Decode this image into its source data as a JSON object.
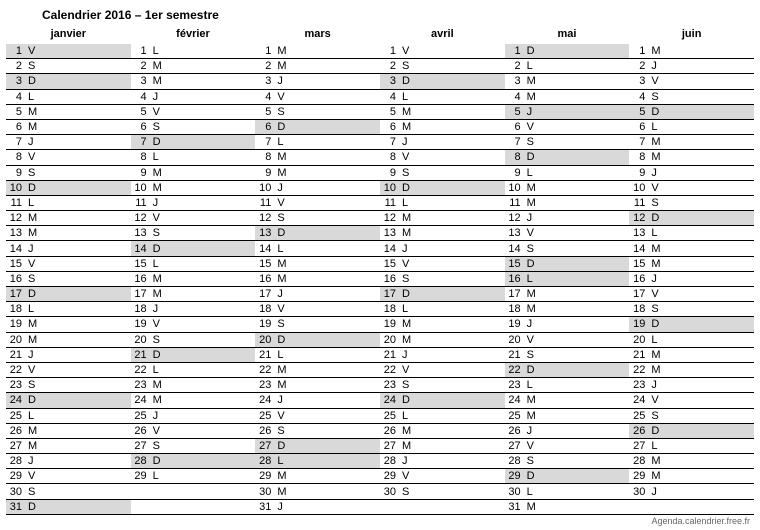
{
  "title": "Calendrier 2016 – 1er semestre",
  "footer": "Agenda.calendrier.free.fr",
  "months": [
    {
      "name": "janvier",
      "days": [
        {
          "num": 1,
          "dow": "V",
          "shade": true
        },
        {
          "num": 2,
          "dow": "S",
          "shade": false
        },
        {
          "num": 3,
          "dow": "D",
          "shade": true
        },
        {
          "num": 4,
          "dow": "L",
          "shade": false
        },
        {
          "num": 5,
          "dow": "M",
          "shade": false
        },
        {
          "num": 6,
          "dow": "M",
          "shade": false
        },
        {
          "num": 7,
          "dow": "J",
          "shade": false
        },
        {
          "num": 8,
          "dow": "V",
          "shade": false
        },
        {
          "num": 9,
          "dow": "S",
          "shade": false
        },
        {
          "num": 10,
          "dow": "D",
          "shade": true
        },
        {
          "num": 11,
          "dow": "L",
          "shade": false
        },
        {
          "num": 12,
          "dow": "M",
          "shade": false
        },
        {
          "num": 13,
          "dow": "M",
          "shade": false
        },
        {
          "num": 14,
          "dow": "J",
          "shade": false
        },
        {
          "num": 15,
          "dow": "V",
          "shade": false
        },
        {
          "num": 16,
          "dow": "S",
          "shade": false
        },
        {
          "num": 17,
          "dow": "D",
          "shade": true
        },
        {
          "num": 18,
          "dow": "L",
          "shade": false
        },
        {
          "num": 19,
          "dow": "M",
          "shade": false
        },
        {
          "num": 20,
          "dow": "M",
          "shade": false
        },
        {
          "num": 21,
          "dow": "J",
          "shade": false
        },
        {
          "num": 22,
          "dow": "V",
          "shade": false
        },
        {
          "num": 23,
          "dow": "S",
          "shade": false
        },
        {
          "num": 24,
          "dow": "D",
          "shade": true
        },
        {
          "num": 25,
          "dow": "L",
          "shade": false
        },
        {
          "num": 26,
          "dow": "M",
          "shade": false
        },
        {
          "num": 27,
          "dow": "M",
          "shade": false
        },
        {
          "num": 28,
          "dow": "J",
          "shade": false
        },
        {
          "num": 29,
          "dow": "V",
          "shade": false
        },
        {
          "num": 30,
          "dow": "S",
          "shade": false
        },
        {
          "num": 31,
          "dow": "D",
          "shade": true
        }
      ]
    },
    {
      "name": "février",
      "days": [
        {
          "num": 1,
          "dow": "L",
          "shade": false
        },
        {
          "num": 2,
          "dow": "M",
          "shade": false
        },
        {
          "num": 3,
          "dow": "M",
          "shade": false
        },
        {
          "num": 4,
          "dow": "J",
          "shade": false
        },
        {
          "num": 5,
          "dow": "V",
          "shade": false
        },
        {
          "num": 6,
          "dow": "S",
          "shade": false
        },
        {
          "num": 7,
          "dow": "D",
          "shade": true
        },
        {
          "num": 8,
          "dow": "L",
          "shade": false
        },
        {
          "num": 9,
          "dow": "M",
          "shade": false
        },
        {
          "num": 10,
          "dow": "M",
          "shade": false
        },
        {
          "num": 11,
          "dow": "J",
          "shade": false
        },
        {
          "num": 12,
          "dow": "V",
          "shade": false
        },
        {
          "num": 13,
          "dow": "S",
          "shade": false
        },
        {
          "num": 14,
          "dow": "D",
          "shade": true
        },
        {
          "num": 15,
          "dow": "L",
          "shade": false
        },
        {
          "num": 16,
          "dow": "M",
          "shade": false
        },
        {
          "num": 17,
          "dow": "M",
          "shade": false
        },
        {
          "num": 18,
          "dow": "J",
          "shade": false
        },
        {
          "num": 19,
          "dow": "V",
          "shade": false
        },
        {
          "num": 20,
          "dow": "S",
          "shade": false
        },
        {
          "num": 21,
          "dow": "D",
          "shade": true
        },
        {
          "num": 22,
          "dow": "L",
          "shade": false
        },
        {
          "num": 23,
          "dow": "M",
          "shade": false
        },
        {
          "num": 24,
          "dow": "M",
          "shade": false
        },
        {
          "num": 25,
          "dow": "J",
          "shade": false
        },
        {
          "num": 26,
          "dow": "V",
          "shade": false
        },
        {
          "num": 27,
          "dow": "S",
          "shade": false
        },
        {
          "num": 28,
          "dow": "D",
          "shade": true
        },
        {
          "num": 29,
          "dow": "L",
          "shade": false
        }
      ]
    },
    {
      "name": "mars",
      "days": [
        {
          "num": 1,
          "dow": "M",
          "shade": false
        },
        {
          "num": 2,
          "dow": "M",
          "shade": false
        },
        {
          "num": 3,
          "dow": "J",
          "shade": false
        },
        {
          "num": 4,
          "dow": "V",
          "shade": false
        },
        {
          "num": 5,
          "dow": "S",
          "shade": false
        },
        {
          "num": 6,
          "dow": "D",
          "shade": true
        },
        {
          "num": 7,
          "dow": "L",
          "shade": false
        },
        {
          "num": 8,
          "dow": "M",
          "shade": false
        },
        {
          "num": 9,
          "dow": "M",
          "shade": false
        },
        {
          "num": 10,
          "dow": "J",
          "shade": false
        },
        {
          "num": 11,
          "dow": "V",
          "shade": false
        },
        {
          "num": 12,
          "dow": "S",
          "shade": false
        },
        {
          "num": 13,
          "dow": "D",
          "shade": true
        },
        {
          "num": 14,
          "dow": "L",
          "shade": false
        },
        {
          "num": 15,
          "dow": "M",
          "shade": false
        },
        {
          "num": 16,
          "dow": "M",
          "shade": false
        },
        {
          "num": 17,
          "dow": "J",
          "shade": false
        },
        {
          "num": 18,
          "dow": "V",
          "shade": false
        },
        {
          "num": 19,
          "dow": "S",
          "shade": false
        },
        {
          "num": 20,
          "dow": "D",
          "shade": true
        },
        {
          "num": 21,
          "dow": "L",
          "shade": false
        },
        {
          "num": 22,
          "dow": "M",
          "shade": false
        },
        {
          "num": 23,
          "dow": "M",
          "shade": false
        },
        {
          "num": 24,
          "dow": "J",
          "shade": false
        },
        {
          "num": 25,
          "dow": "V",
          "shade": false
        },
        {
          "num": 26,
          "dow": "S",
          "shade": false
        },
        {
          "num": 27,
          "dow": "D",
          "shade": true
        },
        {
          "num": 28,
          "dow": "L",
          "shade": true
        },
        {
          "num": 29,
          "dow": "M",
          "shade": false
        },
        {
          "num": 30,
          "dow": "M",
          "shade": false
        },
        {
          "num": 31,
          "dow": "J",
          "shade": false
        }
      ]
    },
    {
      "name": "avril",
      "days": [
        {
          "num": 1,
          "dow": "V",
          "shade": false
        },
        {
          "num": 2,
          "dow": "S",
          "shade": false
        },
        {
          "num": 3,
          "dow": "D",
          "shade": true
        },
        {
          "num": 4,
          "dow": "L",
          "shade": false
        },
        {
          "num": 5,
          "dow": "M",
          "shade": false
        },
        {
          "num": 6,
          "dow": "M",
          "shade": false
        },
        {
          "num": 7,
          "dow": "J",
          "shade": false
        },
        {
          "num": 8,
          "dow": "V",
          "shade": false
        },
        {
          "num": 9,
          "dow": "S",
          "shade": false
        },
        {
          "num": 10,
          "dow": "D",
          "shade": true
        },
        {
          "num": 11,
          "dow": "L",
          "shade": false
        },
        {
          "num": 12,
          "dow": "M",
          "shade": false
        },
        {
          "num": 13,
          "dow": "M",
          "shade": false
        },
        {
          "num": 14,
          "dow": "J",
          "shade": false
        },
        {
          "num": 15,
          "dow": "V",
          "shade": false
        },
        {
          "num": 16,
          "dow": "S",
          "shade": false
        },
        {
          "num": 17,
          "dow": "D",
          "shade": true
        },
        {
          "num": 18,
          "dow": "L",
          "shade": false
        },
        {
          "num": 19,
          "dow": "M",
          "shade": false
        },
        {
          "num": 20,
          "dow": "M",
          "shade": false
        },
        {
          "num": 21,
          "dow": "J",
          "shade": false
        },
        {
          "num": 22,
          "dow": "V",
          "shade": false
        },
        {
          "num": 23,
          "dow": "S",
          "shade": false
        },
        {
          "num": 24,
          "dow": "D",
          "shade": true
        },
        {
          "num": 25,
          "dow": "L",
          "shade": false
        },
        {
          "num": 26,
          "dow": "M",
          "shade": false
        },
        {
          "num": 27,
          "dow": "M",
          "shade": false
        },
        {
          "num": 28,
          "dow": "J",
          "shade": false
        },
        {
          "num": 29,
          "dow": "V",
          "shade": false
        },
        {
          "num": 30,
          "dow": "S",
          "shade": false
        }
      ]
    },
    {
      "name": "mai",
      "days": [
        {
          "num": 1,
          "dow": "D",
          "shade": true
        },
        {
          "num": 2,
          "dow": "L",
          "shade": false
        },
        {
          "num": 3,
          "dow": "M",
          "shade": false
        },
        {
          "num": 4,
          "dow": "M",
          "shade": false
        },
        {
          "num": 5,
          "dow": "J",
          "shade": true
        },
        {
          "num": 6,
          "dow": "V",
          "shade": false
        },
        {
          "num": 7,
          "dow": "S",
          "shade": false
        },
        {
          "num": 8,
          "dow": "D",
          "shade": true
        },
        {
          "num": 9,
          "dow": "L",
          "shade": false
        },
        {
          "num": 10,
          "dow": "M",
          "shade": false
        },
        {
          "num": 11,
          "dow": "M",
          "shade": false
        },
        {
          "num": 12,
          "dow": "J",
          "shade": false
        },
        {
          "num": 13,
          "dow": "V",
          "shade": false
        },
        {
          "num": 14,
          "dow": "S",
          "shade": false
        },
        {
          "num": 15,
          "dow": "D",
          "shade": true
        },
        {
          "num": 16,
          "dow": "L",
          "shade": true
        },
        {
          "num": 17,
          "dow": "M",
          "shade": false
        },
        {
          "num": 18,
          "dow": "M",
          "shade": false
        },
        {
          "num": 19,
          "dow": "J",
          "shade": false
        },
        {
          "num": 20,
          "dow": "V",
          "shade": false
        },
        {
          "num": 21,
          "dow": "S",
          "shade": false
        },
        {
          "num": 22,
          "dow": "D",
          "shade": true
        },
        {
          "num": 23,
          "dow": "L",
          "shade": false
        },
        {
          "num": 24,
          "dow": "M",
          "shade": false
        },
        {
          "num": 25,
          "dow": "M",
          "shade": false
        },
        {
          "num": 26,
          "dow": "J",
          "shade": false
        },
        {
          "num": 27,
          "dow": "V",
          "shade": false
        },
        {
          "num": 28,
          "dow": "S",
          "shade": false
        },
        {
          "num": 29,
          "dow": "D",
          "shade": true
        },
        {
          "num": 30,
          "dow": "L",
          "shade": false
        },
        {
          "num": 31,
          "dow": "M",
          "shade": false
        }
      ]
    },
    {
      "name": "juin",
      "days": [
        {
          "num": 1,
          "dow": "M",
          "shade": false
        },
        {
          "num": 2,
          "dow": "J",
          "shade": false
        },
        {
          "num": 3,
          "dow": "V",
          "shade": false
        },
        {
          "num": 4,
          "dow": "S",
          "shade": false
        },
        {
          "num": 5,
          "dow": "D",
          "shade": true
        },
        {
          "num": 6,
          "dow": "L",
          "shade": false
        },
        {
          "num": 7,
          "dow": "M",
          "shade": false
        },
        {
          "num": 8,
          "dow": "M",
          "shade": false
        },
        {
          "num": 9,
          "dow": "J",
          "shade": false
        },
        {
          "num": 10,
          "dow": "V",
          "shade": false
        },
        {
          "num": 11,
          "dow": "S",
          "shade": false
        },
        {
          "num": 12,
          "dow": "D",
          "shade": true
        },
        {
          "num": 13,
          "dow": "L",
          "shade": false
        },
        {
          "num": 14,
          "dow": "M",
          "shade": false
        },
        {
          "num": 15,
          "dow": "M",
          "shade": false
        },
        {
          "num": 16,
          "dow": "J",
          "shade": false
        },
        {
          "num": 17,
          "dow": "V",
          "shade": false
        },
        {
          "num": 18,
          "dow": "S",
          "shade": false
        },
        {
          "num": 19,
          "dow": "D",
          "shade": true
        },
        {
          "num": 20,
          "dow": "L",
          "shade": false
        },
        {
          "num": 21,
          "dow": "M",
          "shade": false
        },
        {
          "num": 22,
          "dow": "M",
          "shade": false
        },
        {
          "num": 23,
          "dow": "J",
          "shade": false
        },
        {
          "num": 24,
          "dow": "V",
          "shade": false
        },
        {
          "num": 25,
          "dow": "S",
          "shade": false
        },
        {
          "num": 26,
          "dow": "D",
          "shade": true
        },
        {
          "num": 27,
          "dow": "L",
          "shade": false
        },
        {
          "num": 28,
          "dow": "M",
          "shade": false
        },
        {
          "num": 29,
          "dow": "M",
          "shade": false
        },
        {
          "num": 30,
          "dow": "J",
          "shade": false
        }
      ]
    }
  ]
}
